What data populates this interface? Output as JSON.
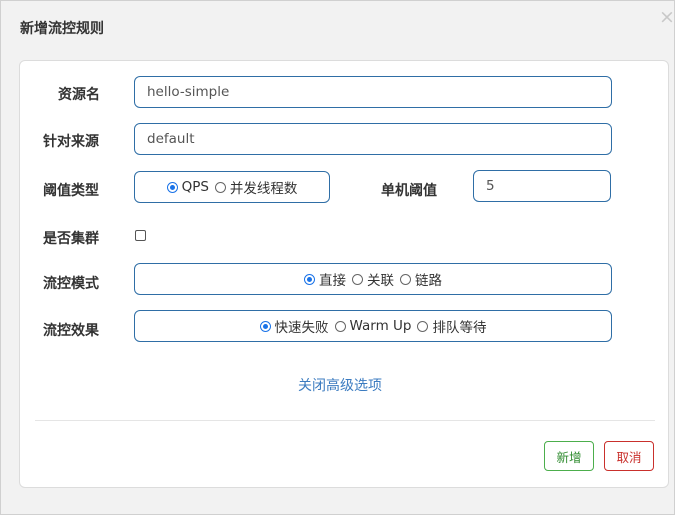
{
  "dialog": {
    "title": "新增流控规则",
    "close_glyph": "×"
  },
  "form": {
    "resource": {
      "label": "资源名",
      "value": "hello-simple"
    },
    "limit_app": {
      "label": "针对来源",
      "value": "default"
    },
    "threshold_type": {
      "label": "阈值类型",
      "options": [
        "QPS",
        "并发线程数"
      ],
      "selected": "QPS"
    },
    "single_threshold": {
      "label": "单机阈值",
      "value": "5"
    },
    "cluster": {
      "label": "是否集群",
      "checked": false
    },
    "strategy": {
      "label": "流控模式",
      "options": [
        "直接",
        "关联",
        "链路"
      ],
      "selected": "直接"
    },
    "control_behavior": {
      "label": "流控效果",
      "options": [
        "快速失败",
        "Warm Up",
        "排队等待"
      ],
      "selected": "快速失败"
    },
    "advanced_toggle": "关闭高级选项"
  },
  "footer": {
    "add_label": "新增",
    "cancel_label": "取消"
  },
  "colors": {
    "field_border": "#2f6ea6",
    "radio_checked": "#1a73e8",
    "link": "#3b7bc0",
    "add_button": "#4cae4c",
    "cancel_button": "#c9302c"
  }
}
